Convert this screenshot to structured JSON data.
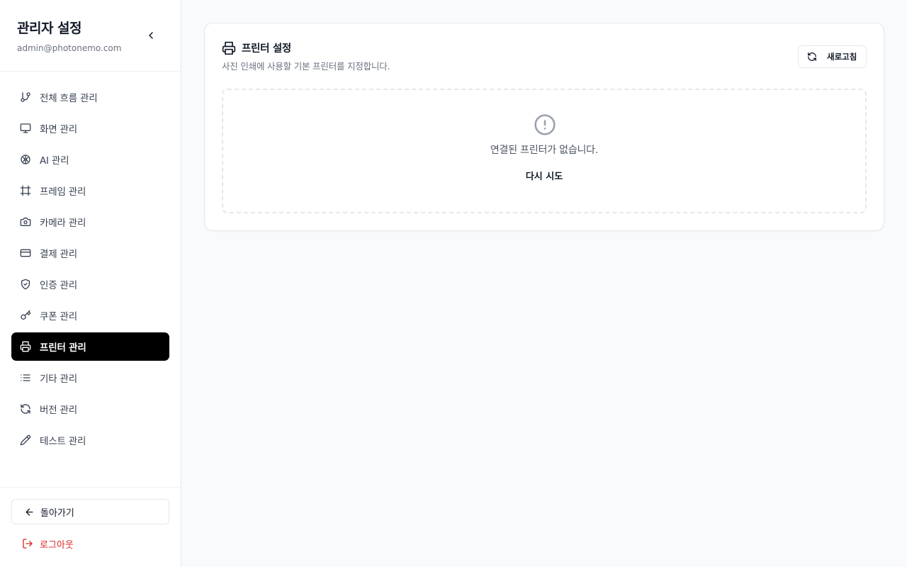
{
  "sidebar": {
    "title": "관리자 설정",
    "email": "admin@photonemo.com",
    "items": [
      {
        "label": "전체 흐름 관리",
        "icon": "git-branch-icon"
      },
      {
        "label": "화면 관리",
        "icon": "monitor-icon"
      },
      {
        "label": "AI 관리",
        "icon": "brain-icon"
      },
      {
        "label": "프레임 관리",
        "icon": "frame-icon"
      },
      {
        "label": "카메라 관리",
        "icon": "camera-icon"
      },
      {
        "label": "결제 관리",
        "icon": "credit-card-icon"
      },
      {
        "label": "인증 관리",
        "icon": "shield-check-icon"
      },
      {
        "label": "쿠폰 관리",
        "icon": "key-icon"
      },
      {
        "label": "프린터 관리",
        "icon": "printer-icon",
        "active": true
      },
      {
        "label": "기타 관리",
        "icon": "list-icon"
      },
      {
        "label": "버전 관리",
        "icon": "refresh-icon"
      },
      {
        "label": "테스트 관리",
        "icon": "pencil-icon"
      }
    ],
    "back_label": "돌아가기",
    "logout_label": "로그아웃"
  },
  "main": {
    "card": {
      "title": "프린터 설정",
      "subtitle": "사진 인쇄에 사용할 기본 프린터를 지정합니다.",
      "refresh_label": "새로고침",
      "empty_message": "연결된 프린터가 없습니다.",
      "retry_label": "다시 시도"
    }
  },
  "colors": {
    "active_bg": "#000000",
    "logout": "#dc2626",
    "muted_text": "#6b7280",
    "page_bg": "#f9fafb"
  }
}
